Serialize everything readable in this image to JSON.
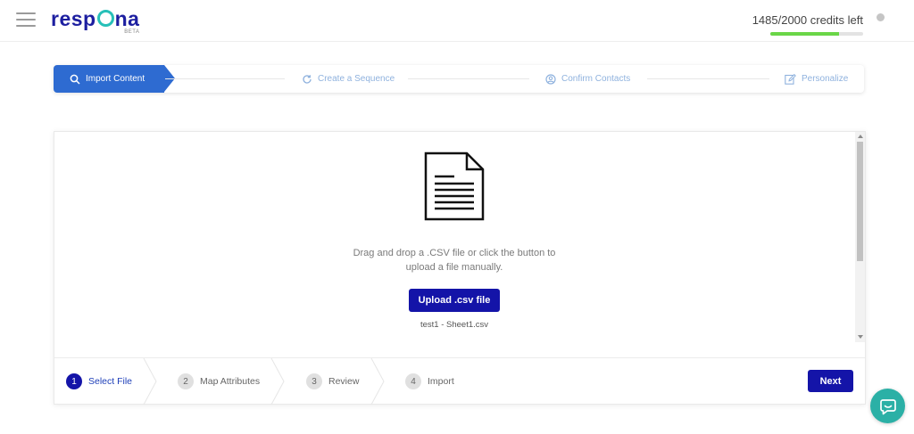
{
  "header": {
    "brand_left": "resp",
    "brand_right": "na",
    "brand_tag": "BETA",
    "credits_text": "1485/2000 credits left",
    "credits_used_fraction": 0.7425,
    "icons": {
      "menu": "hamburger-icon",
      "info": "info-dot-icon"
    }
  },
  "wizard": {
    "steps": [
      {
        "label": "Import Content",
        "icon": "search-icon",
        "active": true
      },
      {
        "label": "Create a Sequence",
        "icon": "refresh-icon",
        "active": false
      },
      {
        "label": "Confirm Contacts",
        "icon": "user-circle-icon",
        "active": false
      },
      {
        "label": "Personalize",
        "icon": "edit-icon",
        "active": false
      }
    ]
  },
  "upload": {
    "icon": "document-icon",
    "line1": "Drag and drop a .CSV file or click the button to",
    "line2": "upload a file manually.",
    "button_label": "Upload .csv file",
    "file_name": "test1 - Sheet1.csv"
  },
  "footer": {
    "steps": [
      {
        "number": "1",
        "label": "Select File",
        "active": true
      },
      {
        "number": "2",
        "label": "Map Attributes",
        "active": false
      },
      {
        "number": "3",
        "label": "Review",
        "active": false
      },
      {
        "number": "4",
        "label": "Import",
        "active": false
      }
    ],
    "next_label": "Next"
  },
  "chat": {
    "icon": "chat-icon"
  },
  "colors": {
    "brand": "#1d1fa0",
    "accent_teal": "#27c0b8",
    "primary_button": "#1414a8",
    "wizard_active": "#2e6bd1",
    "progress": "#6ad647"
  }
}
